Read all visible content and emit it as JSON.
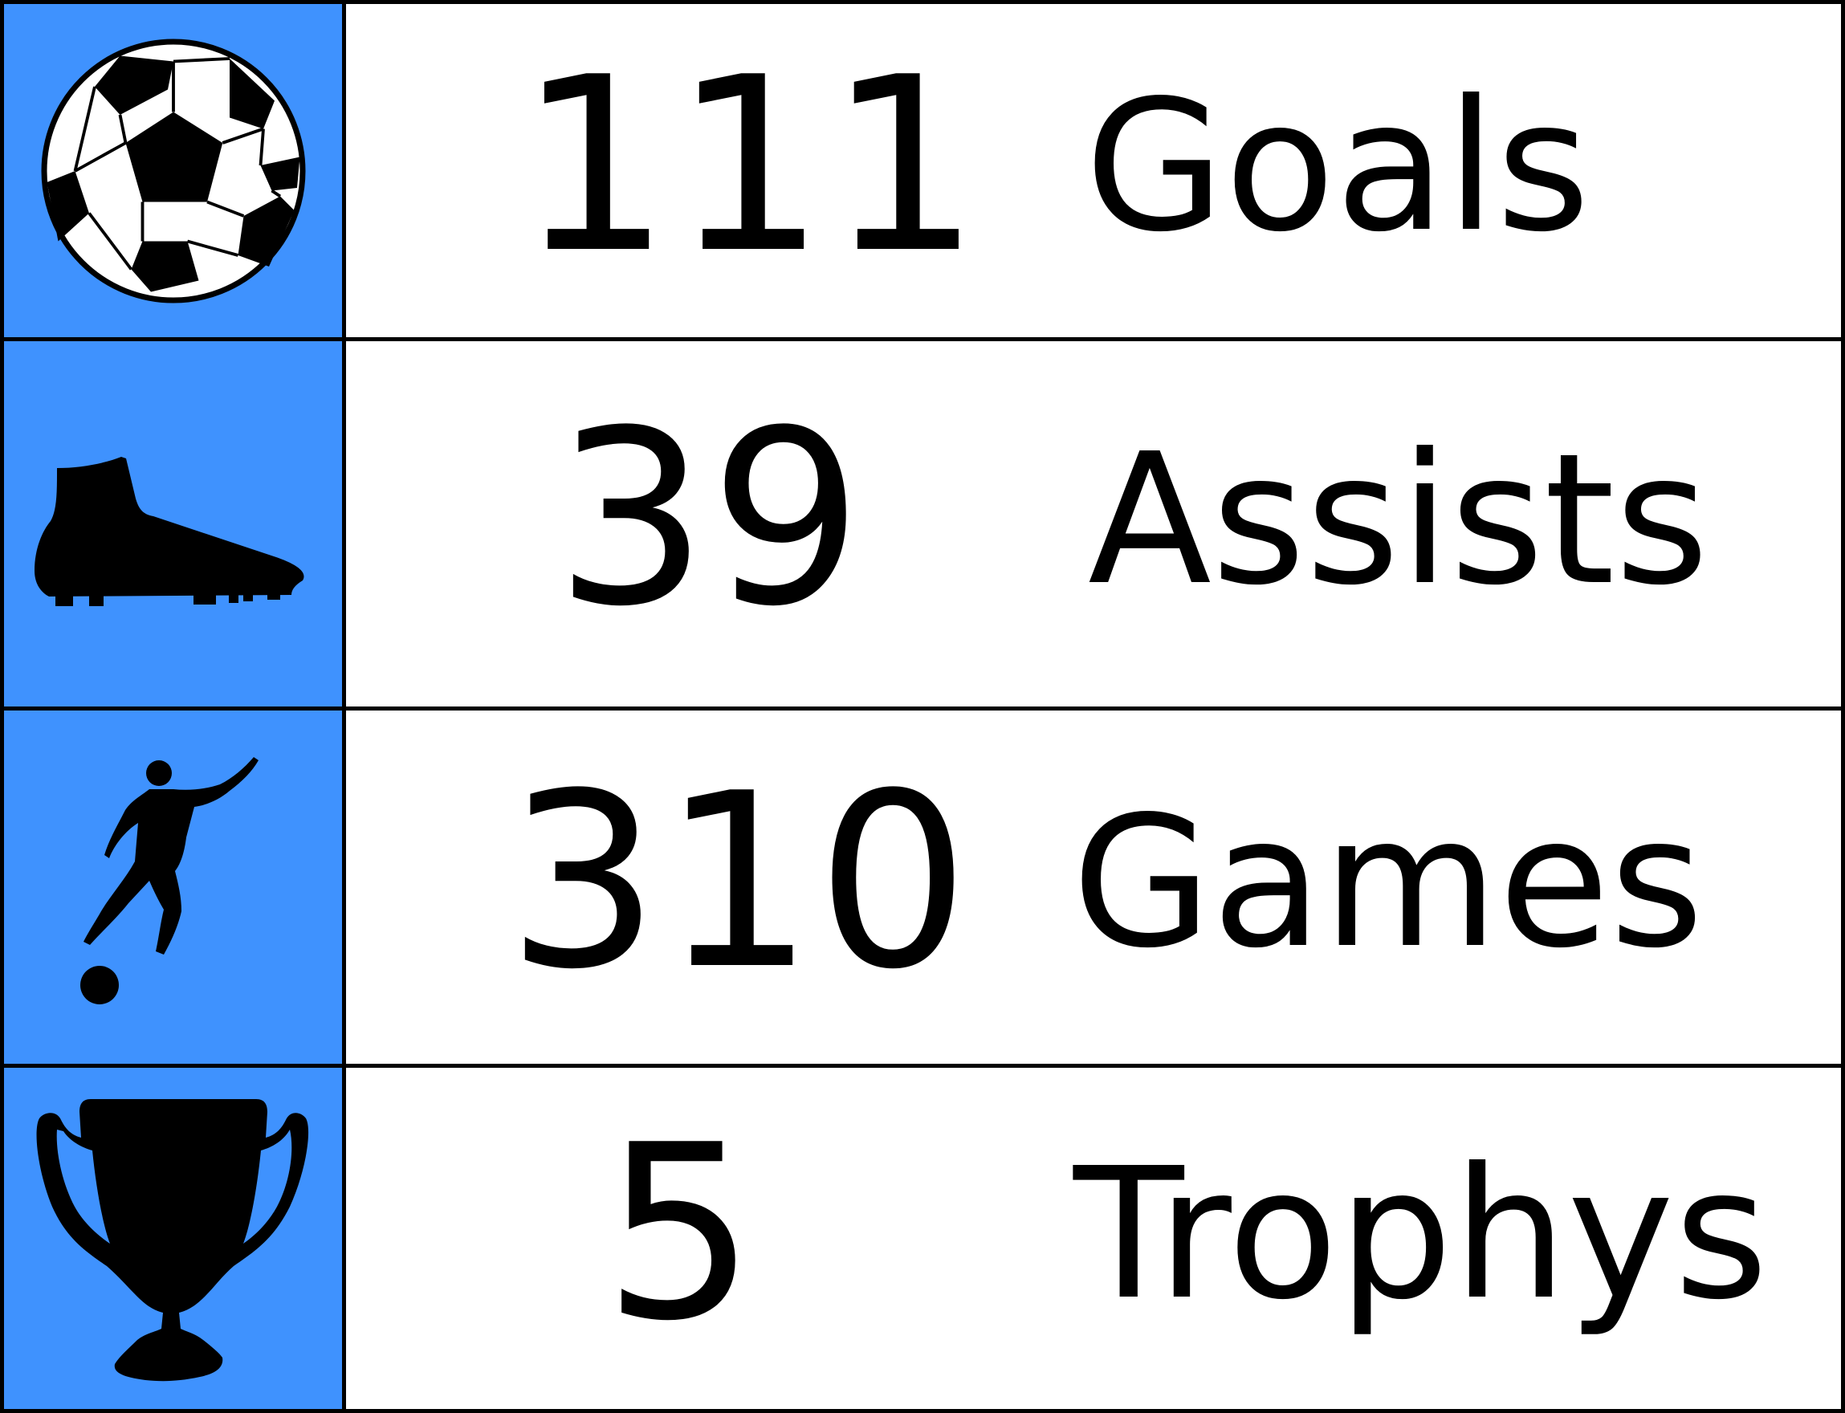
{
  "colors": {
    "icon_background": "#3f92fe",
    "border": "#000000",
    "text": "#000000"
  },
  "stats": [
    {
      "value": "111",
      "label": "Goals",
      "icon": "soccer-ball-icon"
    },
    {
      "value": "39",
      "label": "Assists",
      "icon": "football-boot-icon"
    },
    {
      "value": "310",
      "label": "Games",
      "icon": "player-kicking-icon"
    },
    {
      "value": "5",
      "label": "Trophys",
      "icon": "trophy-icon"
    }
  ]
}
